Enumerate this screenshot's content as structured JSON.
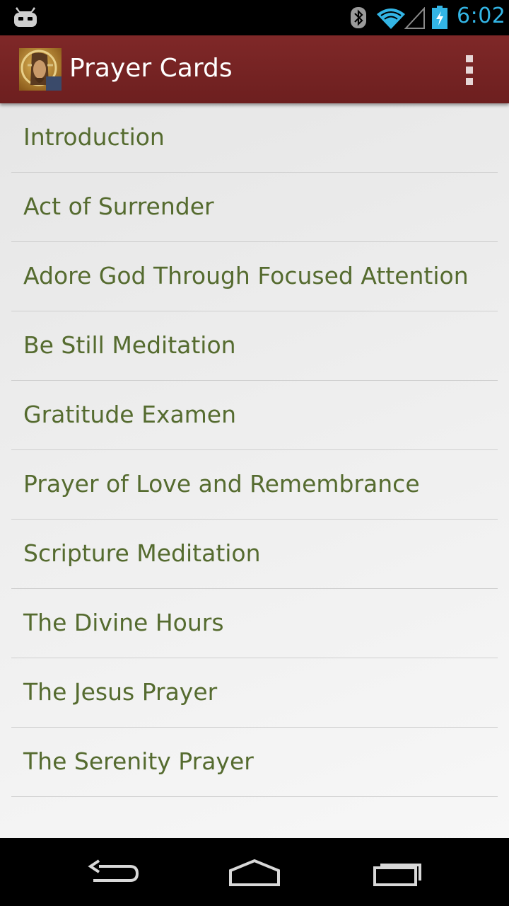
{
  "status_bar": {
    "time": "6:02",
    "icons": [
      "android-notification-icon",
      "bluetooth-icon",
      "wifi-icon",
      "signal-icon",
      "battery-charging-icon"
    ],
    "accent_color": "#33b5e5"
  },
  "action_bar": {
    "title": "Prayer Cards",
    "app_icon": "mosaic-portrait-icon",
    "overflow_icon": "overflow-menu-icon",
    "background_color": "#762323"
  },
  "list": {
    "text_color": "#556b2f",
    "items": [
      {
        "label": "Introduction"
      },
      {
        "label": "Act of Surrender"
      },
      {
        "label": "Adore God Through Focused Attention"
      },
      {
        "label": "Be Still Meditation"
      },
      {
        "label": "Gratitude Examen"
      },
      {
        "label": "Prayer of Love and Remembrance"
      },
      {
        "label": "Scripture Meditation"
      },
      {
        "label": "The Divine Hours"
      },
      {
        "label": "The Jesus Prayer"
      },
      {
        "label": "The Serenity Prayer"
      }
    ]
  },
  "nav_bar": {
    "buttons": [
      "back-icon",
      "home-icon",
      "recents-icon"
    ]
  }
}
